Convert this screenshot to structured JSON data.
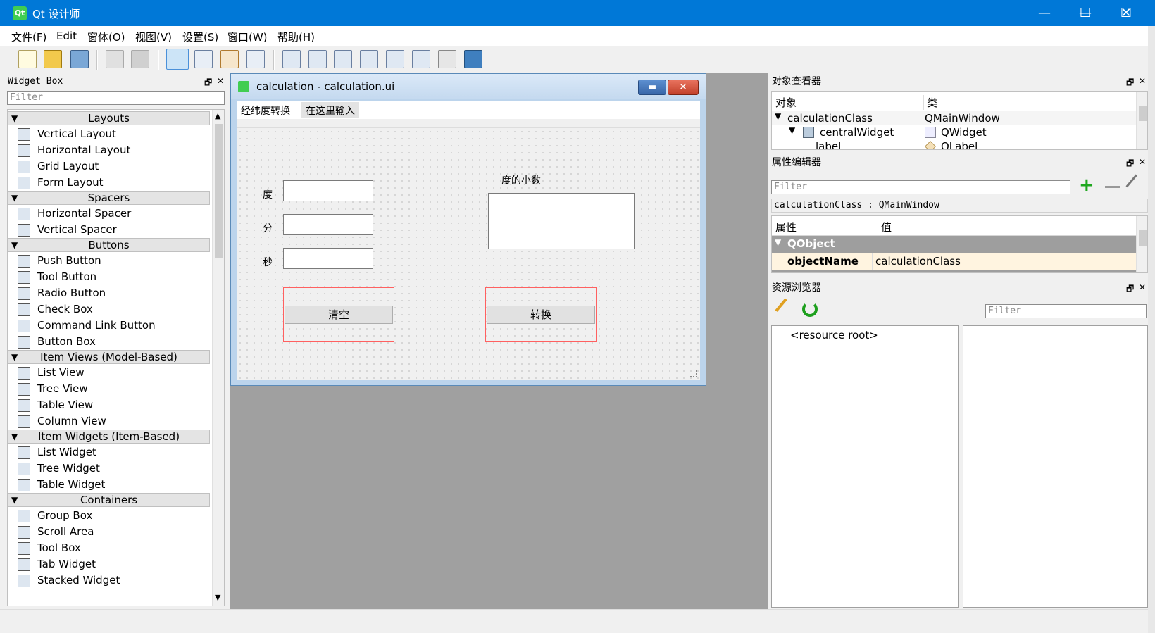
{
  "window": {
    "title": "Qt 设计师",
    "app_icon": "Qt"
  },
  "menu": [
    "文件(F)",
    "Edit",
    "窗体(O)",
    "视图(V)",
    "设置(S)",
    "窗口(W)",
    "帮助(H)"
  ],
  "widget_box": {
    "title": "Widget Box",
    "filter_placeholder": "Filter",
    "categories": [
      {
        "name": "Layouts",
        "items": [
          "Vertical Layout",
          "Horizontal Layout",
          "Grid Layout",
          "Form Layout"
        ]
      },
      {
        "name": "Spacers",
        "items": [
          "Horizontal Spacer",
          "Vertical Spacer"
        ]
      },
      {
        "name": "Buttons",
        "items": [
          "Push Button",
          "Tool Button",
          "Radio Button",
          "Check Box",
          "Command Link Button",
          "Button Box"
        ]
      },
      {
        "name": "Item Views (Model-Based)",
        "items": [
          "List View",
          "Tree View",
          "Table View",
          "Column View"
        ]
      },
      {
        "name": "Item Widgets (Item-Based)",
        "items": [
          "List Widget",
          "Tree Widget",
          "Table Widget"
        ]
      },
      {
        "name": "Containers",
        "items": [
          "Group Box",
          "Scroll Area",
          "Tool Box",
          "Tab Widget",
          "Stacked Widget"
        ]
      }
    ]
  },
  "form": {
    "title": "calculation - calculation.ui",
    "menus": [
      "经纬度转换",
      "在这里输入"
    ],
    "labels": {
      "deg": "度",
      "min": "分",
      "sec": "秒",
      "decimal": "度的小数"
    },
    "buttons": {
      "clear": "清空",
      "convert": "转换"
    }
  },
  "object_inspector": {
    "title": "对象查看器",
    "headers": [
      "对象",
      "类"
    ],
    "rows": [
      {
        "object": "calculationClass",
        "class": "QMainWindow"
      },
      {
        "object": "centralWidget",
        "class": "QWidget"
      },
      {
        "object": "label",
        "class": "QLabel"
      }
    ]
  },
  "property_editor": {
    "title": "属性编辑器",
    "filter_placeholder": "Filter",
    "context": "calculationClass : QMainWindow",
    "headers": [
      "属性",
      "值"
    ],
    "group": "QObject",
    "row": {
      "name": "objectName",
      "value": "calculationClass"
    }
  },
  "resource_browser": {
    "title": "资源浏览器",
    "filter_placeholder": "Filter",
    "root": "<resource root>"
  }
}
